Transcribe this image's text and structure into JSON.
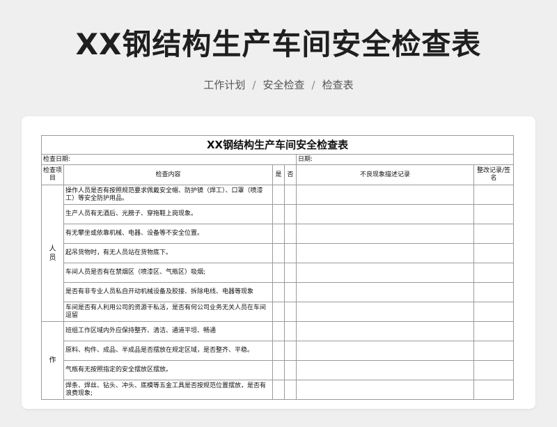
{
  "header": {
    "title": "XX钢结构生产车间安全检查表",
    "breadcrumb": [
      "工作计划",
      "安全检查",
      "检查表"
    ],
    "separator": "/"
  },
  "sheet": {
    "title": "XX钢结构生产车间安全检查表",
    "check_date_label": "检查日期:",
    "date_label": "日期:",
    "columns": {
      "category": "检查项目",
      "content": "检查内容",
      "yes": "是",
      "no": "否",
      "defect": "不良现象描述记录",
      "rectify": "整改记录/签名"
    },
    "categories": [
      {
        "name": "人员",
        "items": [
          "操作人员是否有按照规范要求佩戴安全帽、防护镜（焊工）、口罩（喷漆工）等安全防护用品。",
          "生产人员有无酒后、光膀子、穿拖鞋上岗现象。",
          "有无攀坐或依靠机械、电器、设备等不安全位置。",
          "起吊货物时，有无人员站在货物底下。",
          "车间人员是否有在禁烟区（喷漆区、气瓶区）吸烟;",
          "是否有非专业人员私自开动机械设备及胶接、拆除电线、电器等现象",
          "车间是否有人利用公司的资源干私活，是否有何公司业务无关人员在车间逗留"
        ]
      },
      {
        "name": "作",
        "items": [
          "班组工作区域内外应保持整齐、清洁、通道平坦、畅通",
          "原料、构件、成品、半成品是否摆放在规定区域，是否整齐、平稳。",
          "气瓶有无按照指定的安全摆放区摆放。",
          "焊条、焊丝、钻头、冲头、底模等五金工具是否按规范位置摆放，是否有浪费现象;"
        ]
      }
    ]
  }
}
